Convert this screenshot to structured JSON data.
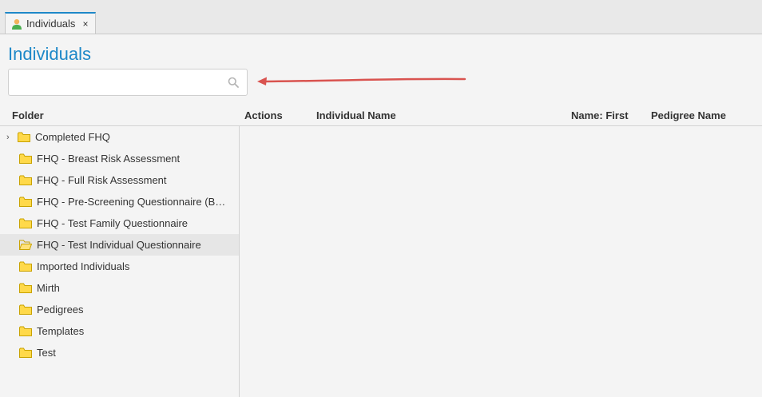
{
  "tabs": [
    {
      "label": "Individuals",
      "icon": "person-icon",
      "close": "×"
    }
  ],
  "page": {
    "title": "Individuals"
  },
  "search": {
    "value": "",
    "placeholder": "",
    "icon": "search-icon"
  },
  "columns": {
    "folder": "Folder",
    "actions": "Actions",
    "individual_name": "Individual Name",
    "name_first": "Name: First",
    "pedigree_name": "Pedigree Name"
  },
  "folders": [
    {
      "label": "Completed FHQ",
      "expandable": true,
      "selected": false
    },
    {
      "label": "FHQ - Breast Risk Assessment",
      "expandable": false,
      "selected": false
    },
    {
      "label": "FHQ - Full Risk Assessment",
      "expandable": false,
      "selected": false
    },
    {
      "label": "FHQ - Pre-Screening Questionnaire (B…",
      "expandable": false,
      "selected": false
    },
    {
      "label": "FHQ - Test Family Questionnaire",
      "expandable": false,
      "selected": false
    },
    {
      "label": "FHQ - Test Individual Questionnaire",
      "expandable": false,
      "selected": true
    },
    {
      "label": "Imported Individuals",
      "expandable": false,
      "selected": false
    },
    {
      "label": "Mirth",
      "expandable": false,
      "selected": false
    },
    {
      "label": "Pedigrees",
      "expandable": false,
      "selected": false
    },
    {
      "label": "Templates",
      "expandable": false,
      "selected": false
    },
    {
      "label": "Test",
      "expandable": false,
      "selected": false
    }
  ],
  "colors": {
    "accent": "#1e88c8",
    "folder_fill": "#ffd94a",
    "folder_stroke": "#c9a200",
    "annotation_arrow": "#d9534f"
  }
}
